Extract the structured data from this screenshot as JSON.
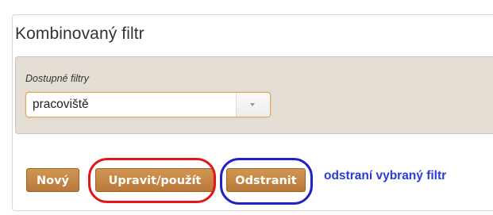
{
  "panel": {
    "title": "Kombinovaný filtr",
    "filters": {
      "label": "Dostupné filtry",
      "selected": "pracoviště",
      "caret_icon": "chevron-down-icon"
    }
  },
  "buttons": {
    "new_label": "Nový",
    "edit_label": "Upravit/použít",
    "delete_label": "Odstranit"
  },
  "annotation": {
    "text": "odstraní vybraný filtr",
    "highlight_colors": {
      "edit": "#e4161c",
      "delete": "#1e22c8"
    }
  },
  "colors": {
    "button": "#c4853f",
    "well": "#e4ded5",
    "annotation_text": "#2b3bd6"
  }
}
